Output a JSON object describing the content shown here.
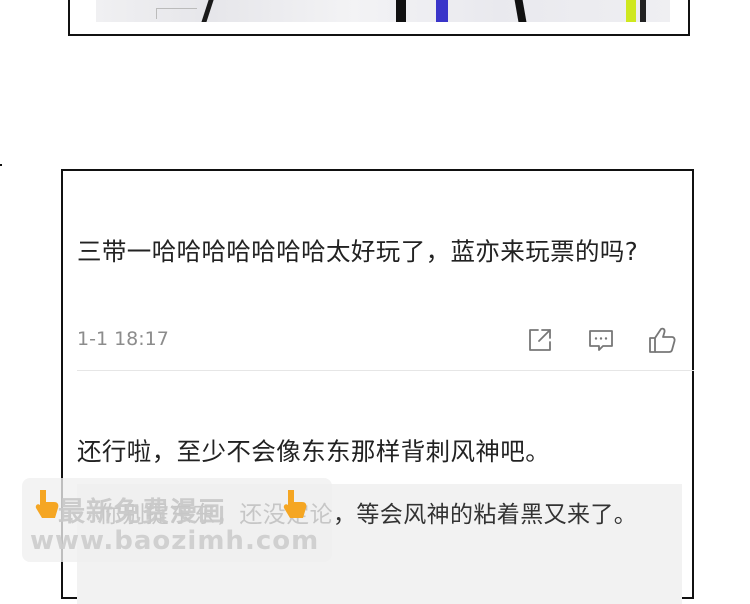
{
  "comments": [
    {
      "text": "三带一哈哈哈哈哈哈哈太好玩了，蓝亦来玩票的吗?",
      "time": "1-1 18:17",
      "actions": {
        "share_icon": "share-icon",
        "reply_icon": "reply-icon",
        "like_icon": "like-icon"
      }
    },
    {
      "text": "还行啦，至少不会像东东那样背刺风神吧。",
      "reply": "你别提东东，还没定论，等会风神的粘着黑又来了。"
    }
  ],
  "watermark": {
    "title": "最新免费漫画",
    "url": "www.baozimh.com",
    "icon": "pointing-hand-icon"
  },
  "colors": {
    "text": "#222222",
    "meta": "#8c8c8c",
    "reply_bg": "#f2f2f2",
    "border": "#111111",
    "hand": "#f5a623"
  }
}
